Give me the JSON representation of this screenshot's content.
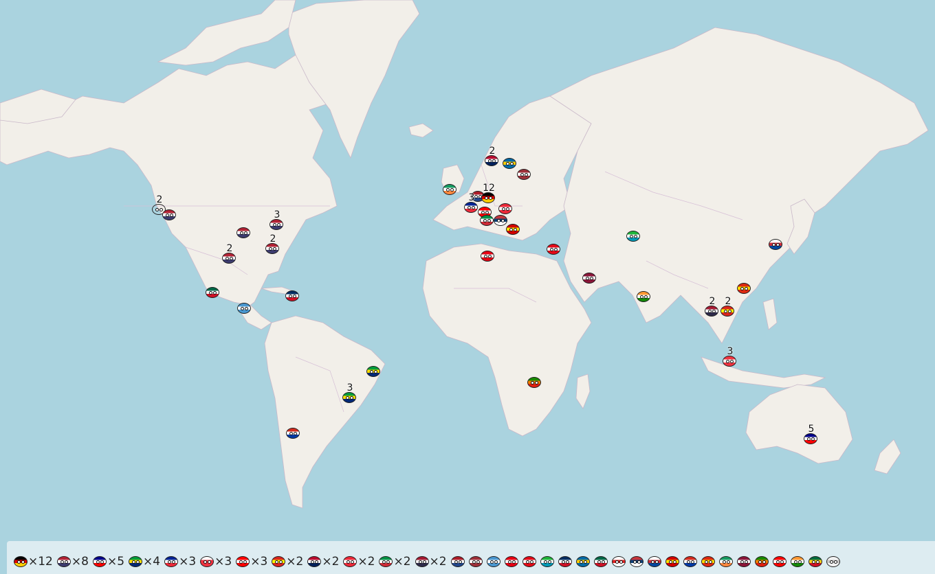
{
  "map": {
    "water_color": "#aad3df",
    "land_color": "#f2efe9"
  },
  "markers": [
    {
      "id": "us-west",
      "country": "Canada-ball",
      "flag": [
        "#ffffff",
        "#dd2222"
      ],
      "count": "2",
      "pos": [
        232,
        304
      ],
      "badge": [
        247,
        296
      ]
    },
    {
      "id": "us-seattle",
      "country": "USA",
      "flag": [
        "#b22234",
        "#ffffff",
        "#3c3b6e"
      ],
      "count": "",
      "pos": [
        247,
        312
      ]
    },
    {
      "id": "us-midwest",
      "country": "USA",
      "flag": [
        "#b22234",
        "#ffffff",
        "#3c3b6e"
      ],
      "count": "",
      "pos": [
        355,
        338
      ]
    },
    {
      "id": "us-texas",
      "country": "USA",
      "flag": [
        "#b22234",
        "#ffffff",
        "#3c3b6e"
      ],
      "count": "2",
      "pos": [
        334,
        375
      ]
    },
    {
      "id": "us-northeast",
      "country": "USA",
      "flag": [
        "#b22234",
        "#ffffff",
        "#3c3b6e"
      ],
      "count": "3",
      "pos": [
        403,
        326
      ]
    },
    {
      "id": "us-southeast",
      "country": "USA",
      "flag": [
        "#b22234",
        "#ffffff",
        "#3c3b6e"
      ],
      "count": "2",
      "pos": [
        397,
        361
      ]
    },
    {
      "id": "mexico",
      "country": "Mexico",
      "flag": [
        "#006847",
        "#ffffff",
        "#ce1126"
      ],
      "count": "",
      "pos": [
        310,
        425
      ]
    },
    {
      "id": "guatemala",
      "country": "Guatemala",
      "flag": [
        "#4997d0",
        "#ffffff",
        "#4997d0"
      ],
      "count": "",
      "pos": [
        356,
        448
      ]
    },
    {
      "id": "dominican",
      "country": "Dominican Republic",
      "flag": [
        "#002d62",
        "#ffffff",
        "#ce1126"
      ],
      "count": "",
      "pos": [
        426,
        430
      ]
    },
    {
      "id": "brazil-east",
      "country": "Brazil",
      "flag": [
        "#009c3b",
        "#ffdf00",
        "#002776"
      ],
      "count": "",
      "pos": [
        544,
        540
      ]
    },
    {
      "id": "brazil-sao",
      "country": "Brazil",
      "flag": [
        "#009c3b",
        "#ffdf00",
        "#002776"
      ],
      "count": "3",
      "pos": [
        509,
        578
      ]
    },
    {
      "id": "chile",
      "country": "Chile",
      "flag": [
        "#d52b1e",
        "#ffffff",
        "#0039a6"
      ],
      "count": "",
      "pos": [
        427,
        630
      ]
    },
    {
      "id": "ireland",
      "country": "Ireland",
      "flag": [
        "#169b62",
        "#ffffff",
        "#ff883e"
      ],
      "count": "",
      "pos": [
        655,
        275
      ]
    },
    {
      "id": "norway",
      "country": "Norway",
      "flag": [
        "#ba0c2f",
        "#ffffff",
        "#00205b"
      ],
      "count": "2",
      "pos": [
        716,
        233
      ]
    },
    {
      "id": "sweden",
      "country": "Sweden",
      "flag": [
        "#006aa7",
        "#fecc00",
        "#006aa7"
      ],
      "count": "",
      "pos": [
        742,
        237
      ]
    },
    {
      "id": "latvia",
      "country": "Latvia",
      "flag": [
        "#9e3039",
        "#ffffff",
        "#9e3039"
      ],
      "count": "",
      "pos": [
        763,
        253
      ]
    },
    {
      "id": "netherlands",
      "country": "Netherlands",
      "flag": [
        "#ae1c28",
        "#ffffff",
        "#21468b"
      ],
      "count": "",
      "pos": [
        696,
        285
      ]
    },
    {
      "id": "germany",
      "country": "Germany",
      "flag": [
        "#000000",
        "#dd0000",
        "#ffce00"
      ],
      "count": "12",
      "pos": [
        711,
        287
      ]
    },
    {
      "id": "france",
      "country": "France",
      "flag": [
        "#002395",
        "#ffffff",
        "#ed2939"
      ],
      "count": "3",
      "pos": [
        686,
        301
      ]
    },
    {
      "id": "switzerland",
      "country": "Switzerland",
      "flag": [
        "#ff0000",
        "#ffffff",
        "#ff0000"
      ],
      "count": "",
      "pos": [
        706,
        308
      ]
    },
    {
      "id": "italy",
      "country": "Italy",
      "flag": [
        "#009246",
        "#ffffff",
        "#ce2b37"
      ],
      "count": "",
      "pos": [
        709,
        320
      ]
    },
    {
      "id": "austria",
      "country": "Austria",
      "flag": [
        "#ed2939",
        "#ffffff",
        "#ed2939"
      ],
      "count": "",
      "pos": [
        736,
        303
      ]
    },
    {
      "id": "serbia",
      "country": "Serbia",
      "flag": [
        "#c6363c",
        "#0c4076",
        "#ffffff"
      ],
      "count": "",
      "pos": [
        729,
        320
      ]
    },
    {
      "id": "macedonia",
      "country": "North Macedonia",
      "flag": [
        "#d20000",
        "#ffe600",
        "#d20000"
      ],
      "count": "",
      "pos": [
        747,
        333
      ]
    },
    {
      "id": "tunisia",
      "country": "Tunisia",
      "flag": [
        "#e70013",
        "#ffffff",
        "#e70013"
      ],
      "count": "",
      "pos": [
        710,
        372
      ]
    },
    {
      "id": "turkey",
      "country": "Turkey",
      "flag": [
        "#e30a17",
        "#ffffff",
        "#e30a17"
      ],
      "count": "",
      "pos": [
        806,
        362
      ]
    },
    {
      "id": "qatar",
      "country": "Qatar",
      "flag": [
        "#8a1538",
        "#ffffff",
        "#8a1538"
      ],
      "count": "",
      "pos": [
        858,
        404
      ]
    },
    {
      "id": "uzbekistan",
      "country": "Uzbekistan",
      "flag": [
        "#1eb53a",
        "#ffffff",
        "#0099b5"
      ],
      "count": "",
      "pos": [
        922,
        343
      ]
    },
    {
      "id": "india",
      "country": "India",
      "flag": [
        "#ff9933",
        "#ffffff",
        "#138808"
      ],
      "count": "",
      "pos": [
        937,
        431
      ]
    },
    {
      "id": "korea",
      "country": "South Korea",
      "flag": [
        "#ffffff",
        "#cd2e3a",
        "#0047a0"
      ],
      "count": "",
      "pos": [
        1129,
        355
      ]
    },
    {
      "id": "hongkong",
      "country": "China",
      "flag": [
        "#de2910",
        "#ffde00",
        "#de2910"
      ],
      "count": "",
      "pos": [
        1083,
        419
      ]
    },
    {
      "id": "thailand",
      "country": "Thailand",
      "flag": [
        "#a51931",
        "#f4f5f8",
        "#2d2a4a"
      ],
      "count": "2",
      "pos": [
        1036,
        452
      ]
    },
    {
      "id": "vietnam",
      "country": "Vietnam",
      "flag": [
        "#da251d",
        "#ffff00",
        "#da251d"
      ],
      "count": "2",
      "pos": [
        1059,
        452
      ]
    },
    {
      "id": "singapore",
      "country": "Singapore",
      "flag": [
        "#ef3340",
        "#ffffff",
        "#ef3340"
      ],
      "count": "3",
      "pos": [
        1062,
        525
      ]
    },
    {
      "id": "zambia",
      "country": "Zambia",
      "flag": [
        "#198a00",
        "#ef7d00",
        "#de2010"
      ],
      "count": "",
      "pos": [
        778,
        556
      ]
    },
    {
      "id": "australia",
      "country": "Australia",
      "flag": [
        "#00008b",
        "#ffffff",
        "#ff0000"
      ],
      "count": "5",
      "pos": [
        1180,
        638
      ]
    }
  ],
  "legend": [
    {
      "label": "×12",
      "flag": [
        "#000000",
        "#dd0000",
        "#ffce00"
      ],
      "name": "germany"
    },
    {
      "label": "×8",
      "flag": [
        "#b22234",
        "#ffffff",
        "#3c3b6e"
      ],
      "name": "usa"
    },
    {
      "label": "×5",
      "flag": [
        "#00008b",
        "#ffffff",
        "#ff0000"
      ],
      "name": "australia"
    },
    {
      "label": "×4",
      "flag": [
        "#009c3b",
        "#ffdf00",
        "#002776"
      ],
      "name": "brazil"
    },
    {
      "label": "×3",
      "flag": [
        "#002395",
        "#ffffff",
        "#ed2939"
      ],
      "name": "france"
    },
    {
      "label": "×3",
      "flag": [
        "#ffffff",
        "#ef3340",
        "#ef3340"
      ],
      "name": "singapore"
    },
    {
      "label": "×3",
      "flag": [
        "#ff0000",
        "#ffffff",
        "#ff0000"
      ],
      "name": "switzerland"
    },
    {
      "label": "×2",
      "flag": [
        "#da251d",
        "#ffff00",
        "#da251d"
      ],
      "name": "vietnam"
    },
    {
      "label": "×2",
      "flag": [
        "#ba0c2f",
        "#ffffff",
        "#00205b"
      ],
      "name": "norway"
    },
    {
      "label": "×2",
      "flag": [
        "#ed2939",
        "#ffffff",
        "#ed2939"
      ],
      "name": "austria"
    },
    {
      "label": "×2",
      "flag": [
        "#009246",
        "#ffffff",
        "#ce2b37"
      ],
      "name": "italy"
    },
    {
      "label": "×2",
      "flag": [
        "#a51931",
        "#f4f5f8",
        "#2d2a4a"
      ],
      "name": "thailand"
    },
    {
      "label": "",
      "flag": [
        "#ae1c28",
        "#ffffff",
        "#21468b"
      ],
      "name": "netherlands"
    },
    {
      "label": "",
      "flag": [
        "#9e3039",
        "#ffffff",
        "#9e3039"
      ],
      "name": "latvia"
    },
    {
      "label": "",
      "flag": [
        "#4997d0",
        "#ffffff",
        "#4997d0"
      ],
      "name": "guatemala"
    },
    {
      "label": "",
      "flag": [
        "#e70013",
        "#ffffff",
        "#e70013"
      ],
      "name": "tunisia"
    },
    {
      "label": "",
      "flag": [
        "#e30a17",
        "#ffffff",
        "#e30a17"
      ],
      "name": "turkey"
    },
    {
      "label": "",
      "flag": [
        "#1eb53a",
        "#ffffff",
        "#0099b5"
      ],
      "name": "uzbekistan"
    },
    {
      "label": "",
      "flag": [
        "#002d62",
        "#ffffff",
        "#ce1126"
      ],
      "name": "dominican"
    },
    {
      "label": "",
      "flag": [
        "#006aa7",
        "#fecc00",
        "#006aa7"
      ],
      "name": "sweden"
    },
    {
      "label": "",
      "flag": [
        "#006847",
        "#ffffff",
        "#ce1126"
      ],
      "name": "mexico"
    },
    {
      "label": "",
      "flag": [
        "#ffffff",
        "#dd2222",
        "#ffffff"
      ],
      "name": "canada"
    },
    {
      "label": "",
      "flag": [
        "#c6363c",
        "#0c4076",
        "#ffffff"
      ],
      "name": "serbia"
    },
    {
      "label": "",
      "flag": [
        "#ffffff",
        "#cd2e3a",
        "#0047a0"
      ],
      "name": "korea"
    },
    {
      "label": "",
      "flag": [
        "#d20000",
        "#ffe600",
        "#d20000"
      ],
      "name": "macedonia"
    },
    {
      "label": "",
      "flag": [
        "#d52b1e",
        "#ffffff",
        "#0039a6"
      ],
      "name": "chile"
    },
    {
      "label": "",
      "flag": [
        "#de2910",
        "#ffde00",
        "#de2910"
      ],
      "name": "china"
    },
    {
      "label": "",
      "flag": [
        "#169b62",
        "#ffffff",
        "#ff883e"
      ],
      "name": "ireland"
    },
    {
      "label": "",
      "flag": [
        "#8a1538",
        "#ffffff",
        "#8a1538"
      ],
      "name": "qatar"
    },
    {
      "label": "",
      "flag": [
        "#198a00",
        "#ef7d00",
        "#de2010"
      ],
      "name": "zambia"
    },
    {
      "label": "",
      "flag": [
        "#ff0000",
        "#ffffff",
        "#ff0000"
      ],
      "name": "peru"
    },
    {
      "label": "",
      "flag": [
        "#ff9933",
        "#ffffff",
        "#138808"
      ],
      "name": "india"
    },
    {
      "label": "",
      "flag": [
        "#006b3f",
        "#fcd116",
        "#ce1126"
      ],
      "name": "ghana"
    },
    {
      "label": "",
      "flag": [
        "#f2f2f2",
        "#c8c8c8",
        "#f2f2f2"
      ],
      "name": "unknown"
    }
  ]
}
